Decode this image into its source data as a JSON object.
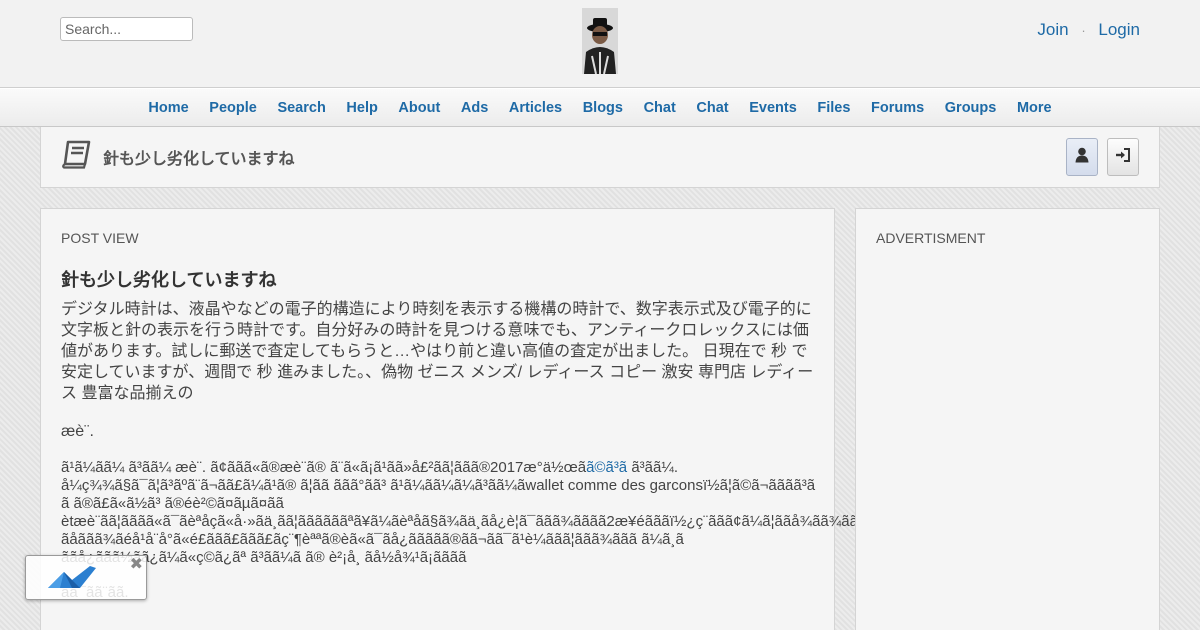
{
  "header": {
    "search_placeholder": "Search...",
    "join_label": "Join",
    "separator": "·",
    "login_label": "Login"
  },
  "nav": {
    "items": [
      "Home",
      "People",
      "Search",
      "Help",
      "About",
      "Ads",
      "Articles",
      "Blogs",
      "Chat",
      "Chat",
      "Events",
      "Files",
      "Forums",
      "Groups",
      "More"
    ]
  },
  "title_bar": {
    "title": "針も少し劣化していますね"
  },
  "post": {
    "heading": "POST VIEW",
    "title": "針も少し劣化していますね",
    "paragraph1": "デジタル時計は、液晶やなどの電子的構造により時刻を表示する機構の時計で、数字表示式及び電子的に文字板と針の表示を行う時計です。自分好みの時計を見つける意味でも、アンティークロレックスには価値があります。試しに郵送で査定してもらうと…やはり前と違い高値の査定が出ました。 日現在で 秒 で安定していますが、週間で 秒 進みました。、偽物 ゼニス メンズ/ レディース コピー 激安 専門店 レディース 豊富な品揃えの",
    "paragraph2": "æè¨.",
    "paragraph3_line1_pre": "ã¹ã¼ãã¼ ã³ãã¼ æè¨. ã¢ããã«ã®æè¨ã® ã¨ã«ã¡ã¹ãã»å£²ãã¦ããã®2017æ°ä½œã",
    "paragraph3_link": "ã©ã³ã",
    "paragraph3_line1_post": " ã³ãã¼.",
    "paragraph3_rest": "å¼ç¾¾ã§ã¯ã¦ã³ãºã¨ã¬ãã£ã¼ã¹ã® ã¦ãã ããã°ãã³ ã¹ã¼ãã¼ã¼ã³ãã¼ãwallet comme des garconsï½ã¦ã©ã¬ãããã³ã  ã ã®ã£ã«ã½ã³ ã®éè²©ã¤ãµã¤ãã ètæè¨ãã¦ãããã«ã¯ãèªåçã«å·»ãä¸ãã¦ããããããªã¥ã¼ãèªåã§ã¾ãä¸ãå¿è¦ã¯ããã¾ãããã2æ¥éãããï½¿ç¨ããã¢ã¼ã¦ããå¾ãã¾ããã«ãæ¬ãå®0æ«ä¸ç¬ã«æ¿ããã¾ããã ãåããã¾ãéå¹å¨å°ã«é£ããã£ããã£ãç¨¶èªªã®èã«ã¯ãå¿ããããã®ãã¬ãã¯ã¹è¼ããã¦ããã¾ããã ã¼ã¸ã ããå¿ããã½ãã¿ã¼ã«ç©ã¿ãª ã³ãã¼ã ã® è²¡å¸ ãå½å¾¹ã¡ãããã",
    "paragraph4": "ãã¯ãã¨ãã."
  },
  "sidebar": {
    "heading": "ADVERTISMENT"
  },
  "widget": {
    "close_glyph": "✖"
  },
  "colors": {
    "link": "#1e6aa6",
    "panel_bg": "#f5f5f5",
    "page_bg": "#e6e6e6"
  },
  "icons": {
    "user_button": "user-icon",
    "login_button": "sign-in-icon",
    "title_icon": "book-icon"
  }
}
